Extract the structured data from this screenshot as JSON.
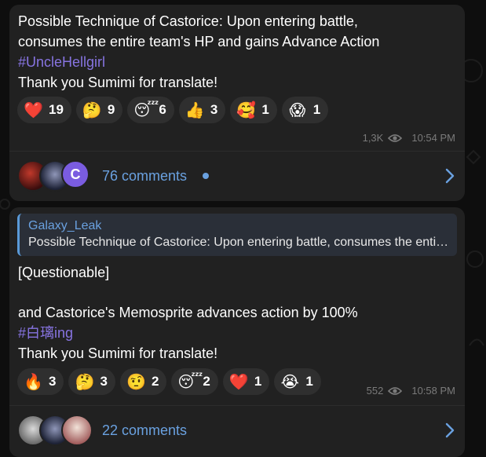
{
  "messages": [
    {
      "lines": [
        "Possible Technique of Castorice: Upon entering battle,",
        "consumes the entire team's HP and gains Advance Action"
      ],
      "hashtag": "#UncleHellgirl",
      "footer_line": "Thank you Sumimi for translate!",
      "reactions": [
        {
          "emoji": "❤️",
          "icon": "heart-icon",
          "count": "19"
        },
        {
          "emoji": "🤔",
          "icon": "thinking-face-icon",
          "count": "9"
        },
        {
          "emoji": "😴",
          "icon": "sleeping-face-icon",
          "count": "6"
        },
        {
          "emoji": "👍",
          "icon": "thumbs-up-icon",
          "count": "3"
        },
        {
          "emoji": "🥰",
          "icon": "smiling-face-hearts-icon",
          "count": "1"
        },
        {
          "emoji": "😱",
          "icon": "screaming-face-icon",
          "count": "1"
        }
      ],
      "views": "1,3K",
      "time": "10:54 PM",
      "comments": {
        "label": "76 comments",
        "avatar_letter": "C",
        "unread": true
      }
    },
    {
      "quote": {
        "author": "Galaxy_Leak",
        "text": "Possible Technique of Castorice: Upon entering battle, consumes the entire team's HP and gains Advance Action"
      },
      "tag": "[Questionable]",
      "line": "and Castorice's Memosprite advances action by 100%",
      "hashtag": "#白璃ing",
      "footer_line": "Thank you Sumimi for translate!",
      "reactions": [
        {
          "emoji": "🔥",
          "icon": "fire-icon",
          "count": "3"
        },
        {
          "emoji": "🤔",
          "icon": "thinking-face-icon",
          "count": "3"
        },
        {
          "emoji": "🤨",
          "icon": "raised-eyebrow-face-icon",
          "count": "2"
        },
        {
          "emoji": "😴",
          "icon": "sleeping-face-icon",
          "count": "2"
        },
        {
          "emoji": "❤️",
          "icon": "heart-icon",
          "count": "1"
        },
        {
          "emoji": "😭",
          "icon": "crying-face-icon",
          "count": "1"
        }
      ],
      "views": "552",
      "time": "10:58 PM",
      "comments": {
        "label": "22 comments"
      }
    }
  ],
  "colors": {
    "background": "#0e0e0e",
    "bubble": "#212121",
    "reaction_pill": "#2f2f2f",
    "link": "#6aa1e0",
    "hashtag": "#8774e1",
    "meta": "#7a7a7a"
  }
}
